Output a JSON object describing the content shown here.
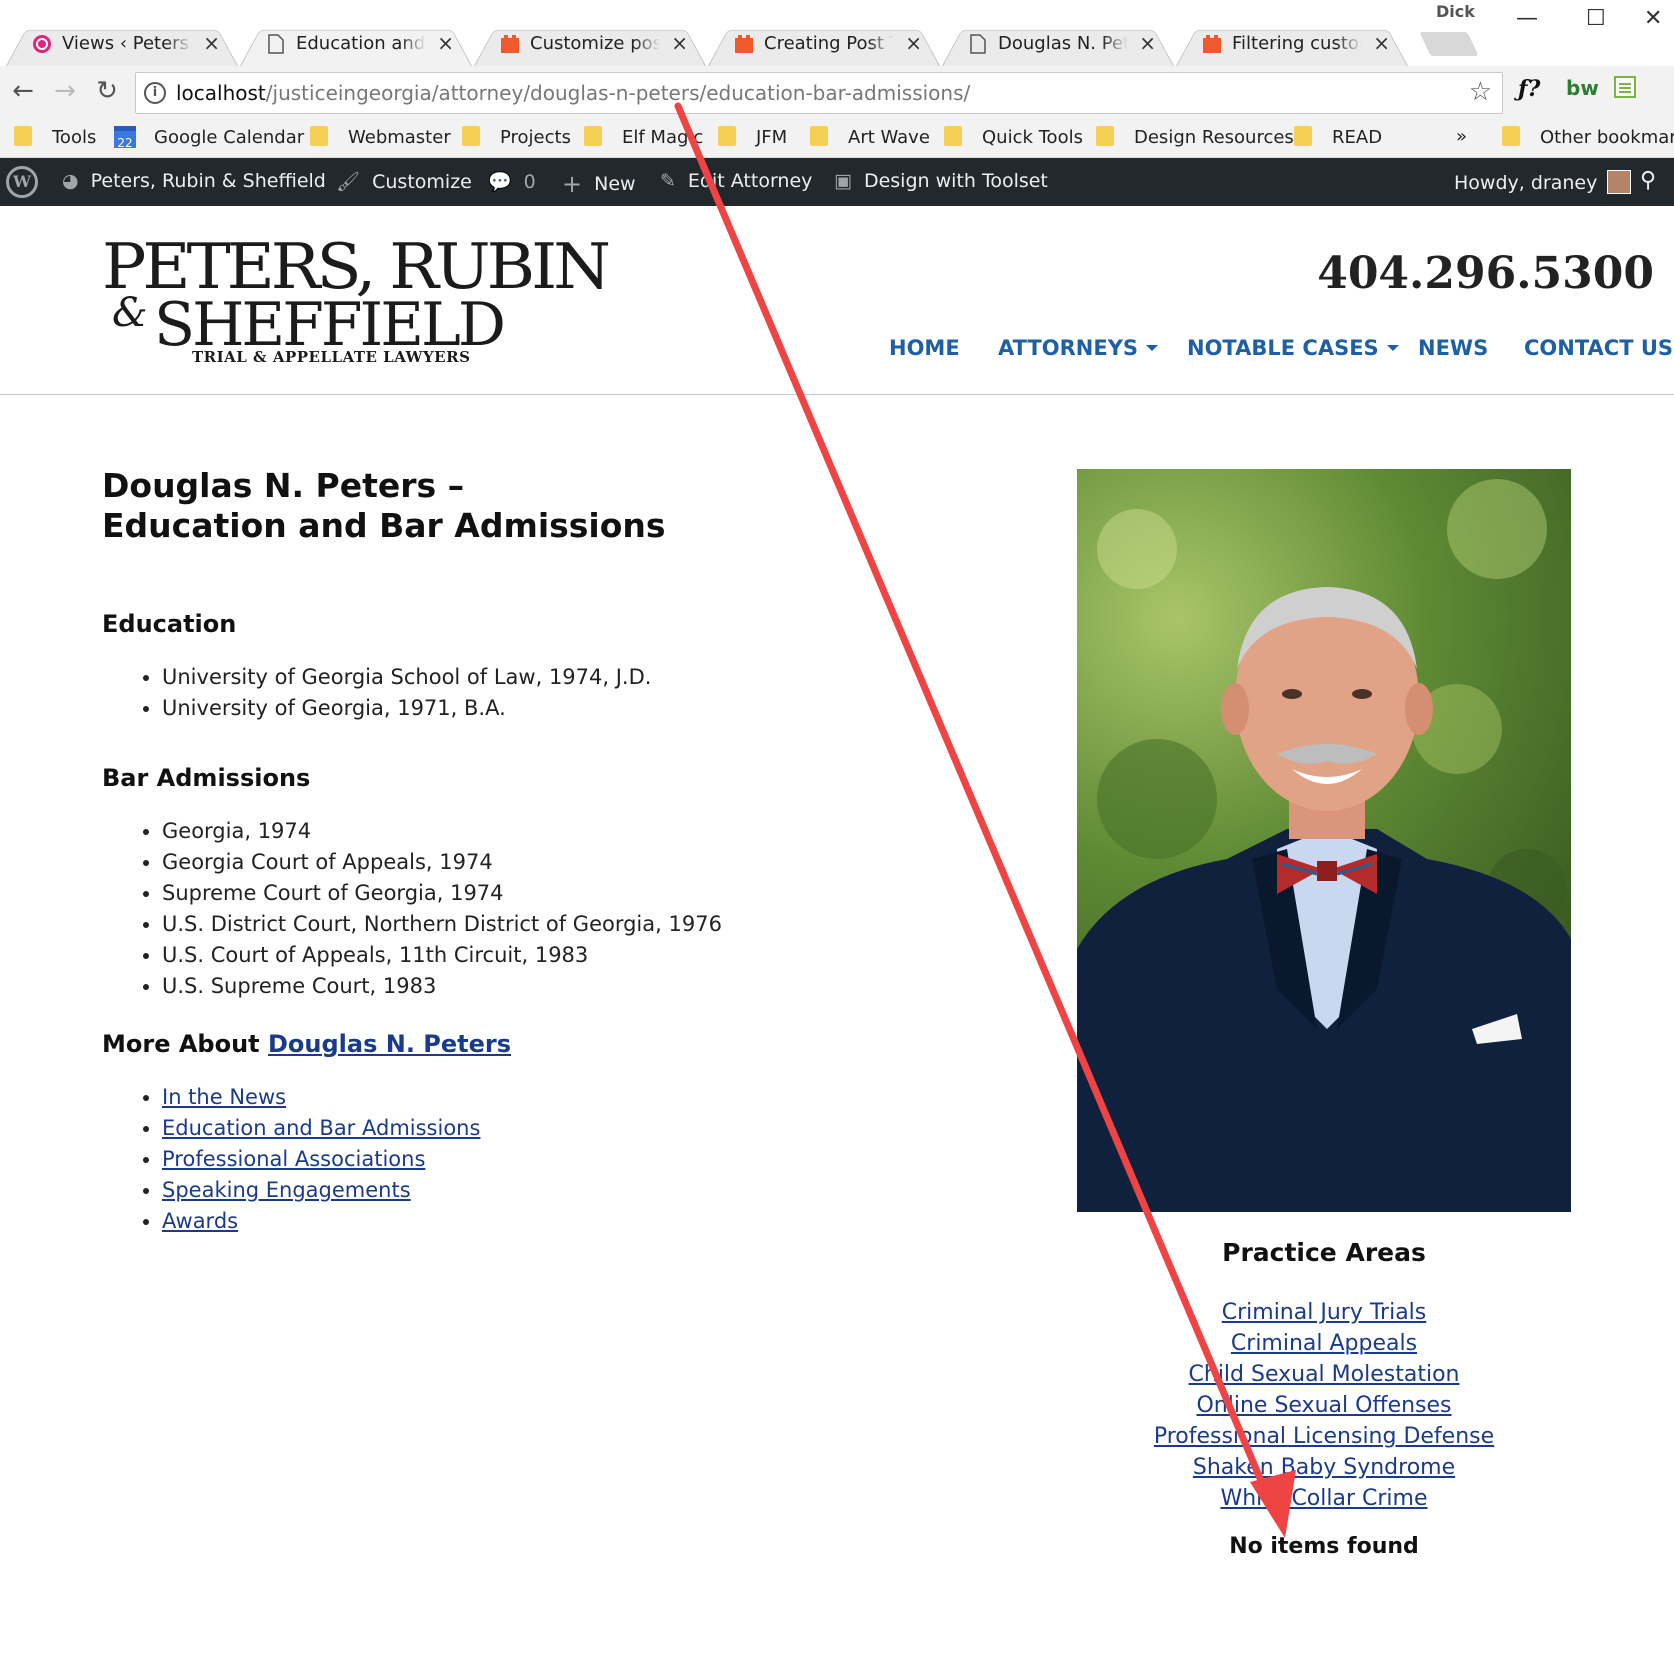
{
  "browser": {
    "profile_name": "Dick",
    "tabs": [
      {
        "title": "Views ‹ Peters, Rubin",
        "icon": "toolset-views-icon"
      },
      {
        "title": "Education and Bar Admissions",
        "icon": "page-icon",
        "active": true
      },
      {
        "title": "Customize post and",
        "icon": "toolset-icon"
      },
      {
        "title": "Creating Post Types",
        "icon": "toolset-icon"
      },
      {
        "title": "Douglas N. Peters",
        "icon": "page-icon"
      },
      {
        "title": "Filtering custom post",
        "icon": "toolset-icon"
      }
    ],
    "url_host": "localhost",
    "url_path": "/justiceingeorgia/attorney/douglas-n-peters/education-bar-admissions/",
    "bookmarks": [
      "Tools",
      "Google Calendar",
      "Webmaster",
      "Projects",
      "Elf Magic",
      "JFM",
      "Art Wave",
      "Quick Tools",
      "Design Resources",
      "READ"
    ],
    "calendar_day": "22",
    "overflow": "»",
    "other_bookmarks": "Other bookmarks"
  },
  "adminbar": {
    "site_name": "Peters, Rubin & Sheffield",
    "customize": "Customize",
    "comments_count": "0",
    "new": "New",
    "edit": "Edit Attorney",
    "design": "Design with Toolset",
    "howdy": "Howdy, draney"
  },
  "site": {
    "logo_line1": "PETERS, RUBIN",
    "logo_amp": "&",
    "logo_line2": "SHEFFIELD",
    "logo_tagline": "TRIAL & APPELLATE LAWYERS",
    "phone": "404.296.5300",
    "nav": [
      "HOME",
      "ATTORNEYS",
      "NOTABLE CASES",
      "NEWS",
      "CONTACT US"
    ]
  },
  "page": {
    "title_line1": "Douglas N. Peters –",
    "title_line2": "Education and Bar Admissions",
    "education_heading": "Education",
    "education": [
      "University of Georgia School of Law, 1974, J.D.",
      "University of Georgia, 1971, B.A."
    ],
    "bar_heading": "Bar Admissions",
    "bar": [
      "Georgia, 1974",
      "Georgia Court of Appeals, 1974",
      "Supreme Court of Georgia, 1974",
      "U.S. District Court, Northern District of Georgia, 1976",
      "U.S. Court of Appeals, 11th Circuit, 1983",
      "U.S. Supreme Court, 1983"
    ],
    "more_prefix": "More About ",
    "more_name": "Douglas N. Peters",
    "more_links": [
      "In the News",
      "Education and Bar Admissions",
      "Professional Associations",
      "Speaking Engagements",
      "Awards"
    ]
  },
  "sidebar": {
    "practice_heading": "Practice Areas",
    "practice_areas": [
      "Criminal Jury Trials",
      "Criminal Appeals",
      "Child Sexual Molestation",
      "Online Sexual Offenses",
      "Professional Licensing Defense",
      "Shaken Baby Syndrome",
      "White Collar Crime"
    ],
    "no_items": "No items found"
  },
  "colors": {
    "nav_blue": "#1f5fa3",
    "link_blue": "#1a3a8a",
    "adminbar_bg": "#23282d",
    "annotation_red": "#ef4444"
  }
}
